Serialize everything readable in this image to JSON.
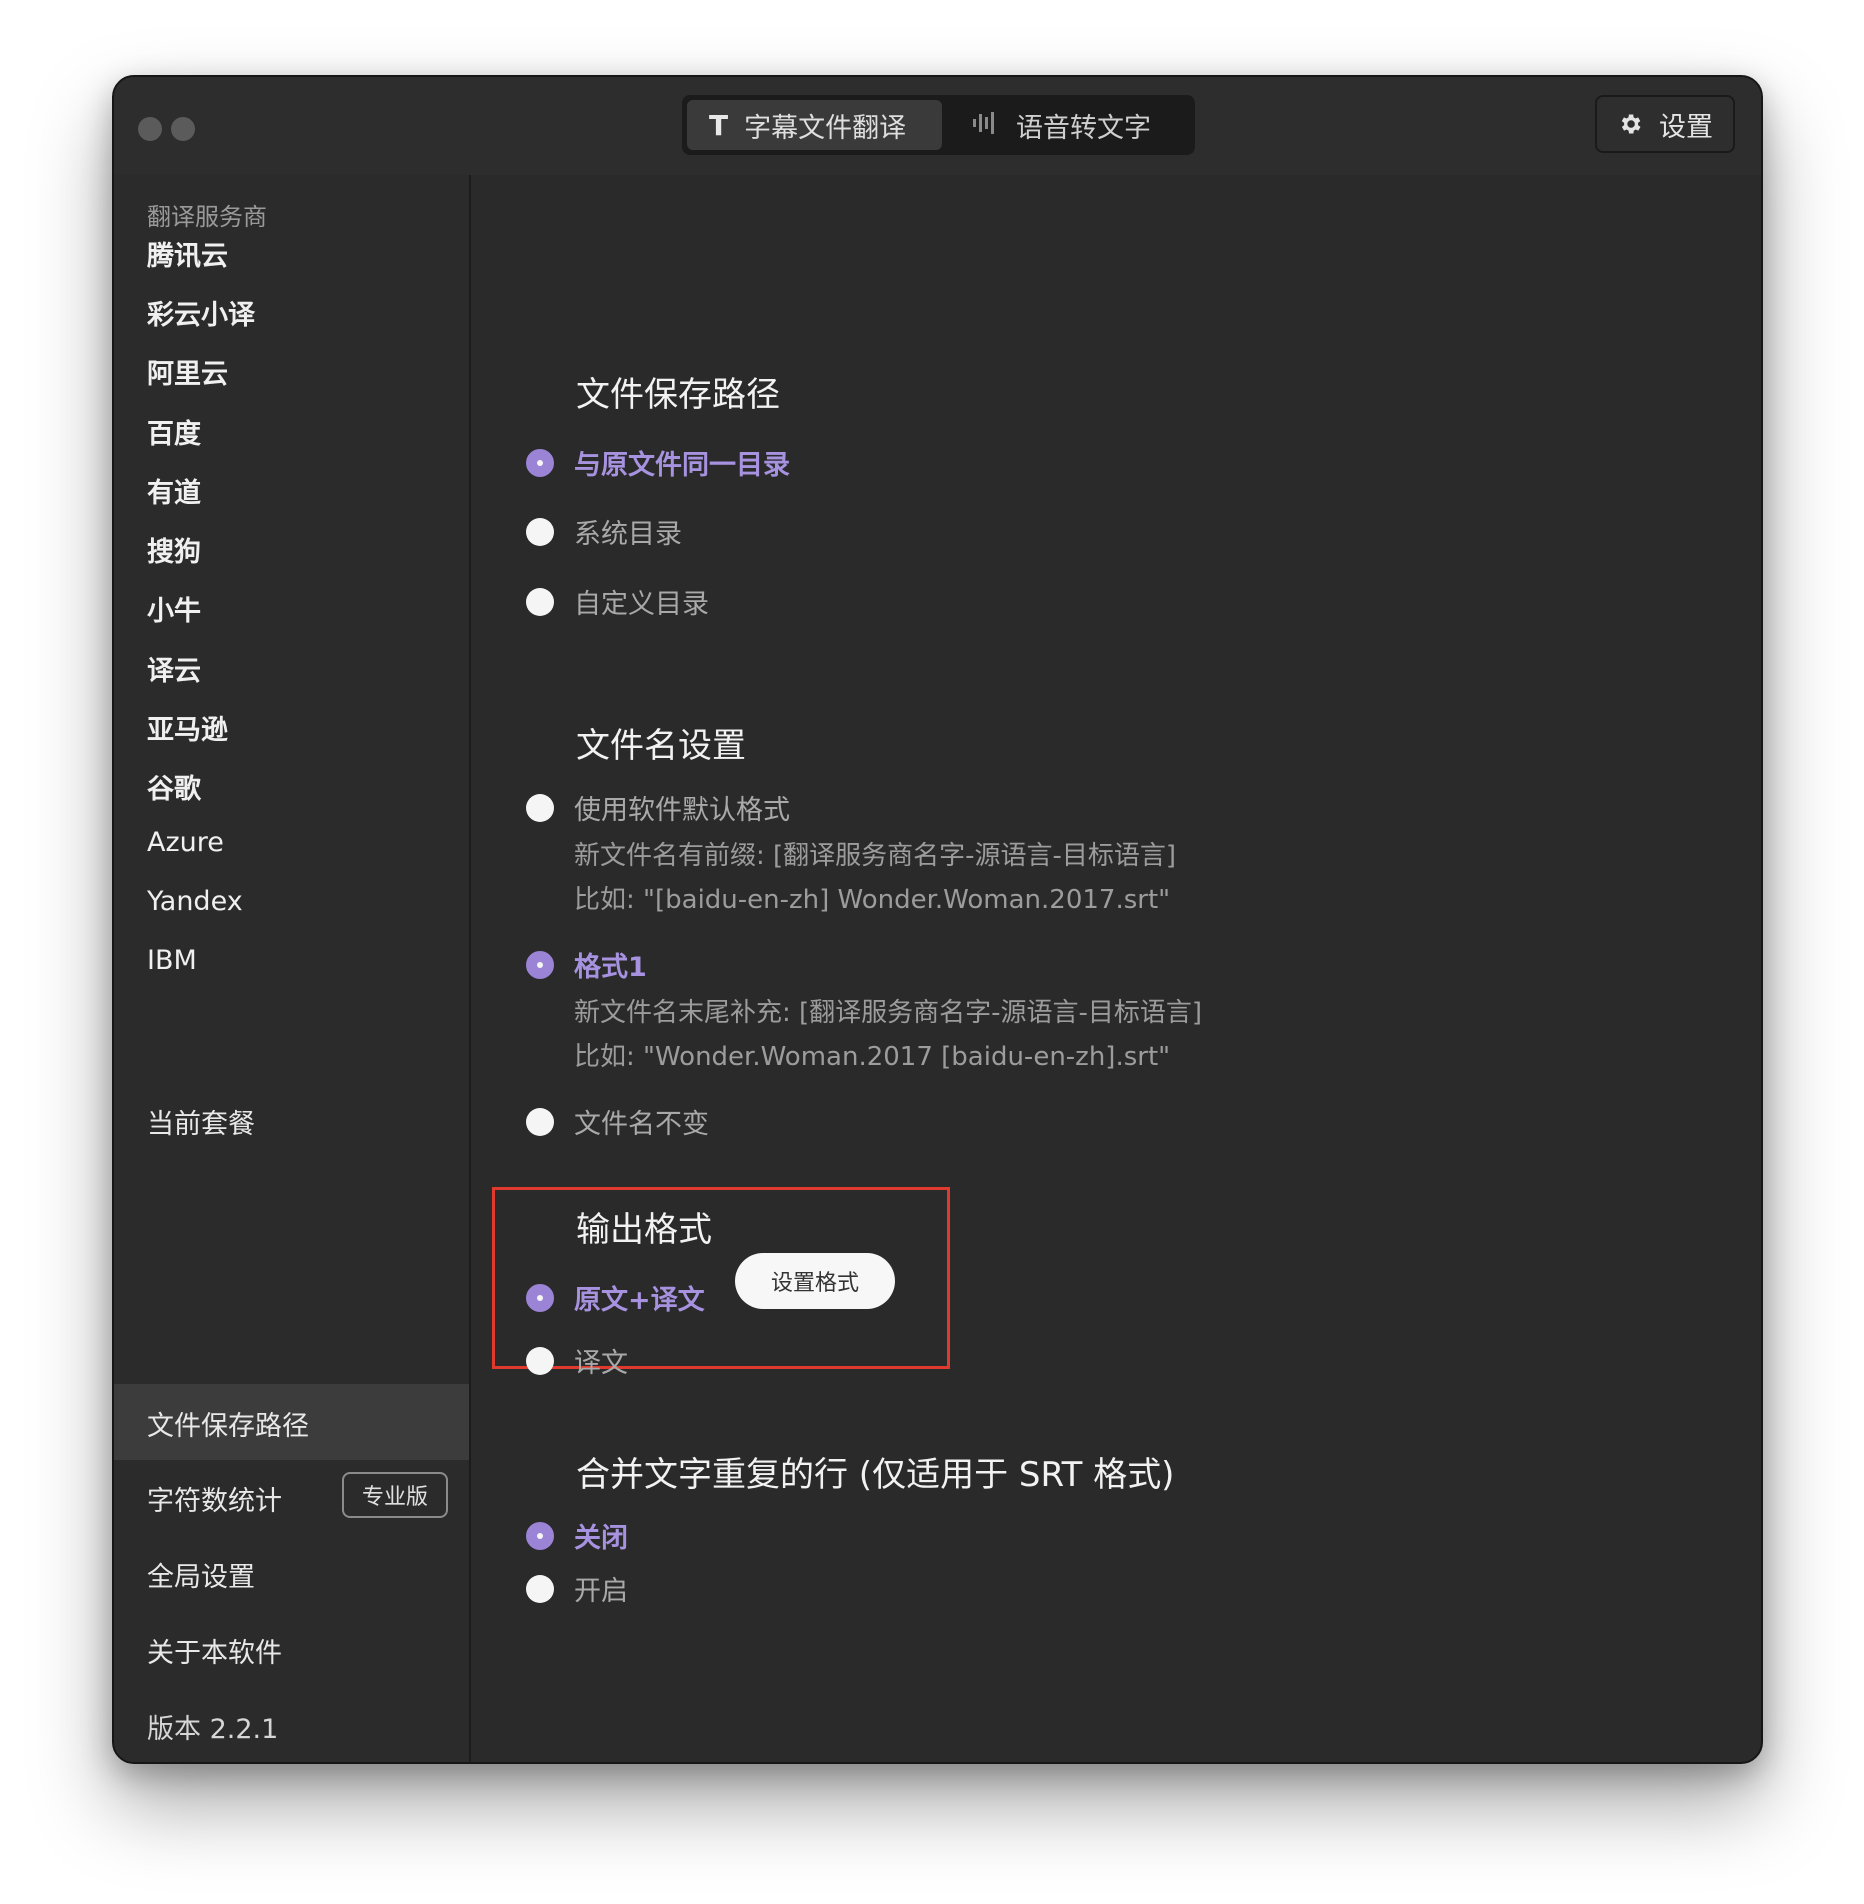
{
  "titlebar": {
    "tabs": [
      {
        "icon": "text-t-icon",
        "label": "字幕文件翻译",
        "active": true
      },
      {
        "icon": "waveform-icon",
        "label": "语音转文字",
        "active": false
      }
    ],
    "settings_label": "设置"
  },
  "sidebar": {
    "heading": "翻译服务商",
    "providers": [
      "腾讯云",
      "彩云小译",
      "阿里云",
      "百度",
      "有道",
      "搜狗",
      "小牛",
      "译云",
      "亚马逊",
      "谷歌",
      "Azure",
      "Yandex",
      "IBM"
    ],
    "bottom_items": {
      "plan": "当前套餐",
      "save_path": "文件保存路径",
      "char_count": "字符数统计",
      "pro_badge": "专业版",
      "global_settings": "全局设置",
      "about": "关于本软件",
      "version": "版本 2.2.1"
    },
    "active_item": "文件保存路径"
  },
  "main": {
    "save_path": {
      "title": "文件保存路径",
      "options": [
        {
          "label": "与原文件同一目录",
          "checked": true
        },
        {
          "label": "系统目录",
          "checked": false
        },
        {
          "label": "自定义目录",
          "checked": false
        }
      ]
    },
    "filename": {
      "title": "文件名设置",
      "options": [
        {
          "label": "使用软件默认格式",
          "checked": false,
          "desc1": "新文件名有前缀: [翻译服务商名字-源语言-目标语言]",
          "desc2": "比如: \"[baidu-en-zh] Wonder.Woman.2017.srt\""
        },
        {
          "label": "格式1",
          "checked": true,
          "desc1": "新文件名末尾补充: [翻译服务商名字-源语言-目标语言]",
          "desc2": "比如: \"Wonder.Woman.2017 [baidu-en-zh].srt\""
        },
        {
          "label": "文件名不变",
          "checked": false
        }
      ]
    },
    "output": {
      "title": "输出格式",
      "options": [
        {
          "label": "原文+译文",
          "checked": true
        },
        {
          "label": "译文",
          "checked": false
        }
      ],
      "format_button": "设置格式"
    },
    "merge": {
      "title": "合并文字重复的行 (仅适用于 SRT 格式)",
      "options": [
        {
          "label": "关闭",
          "checked": true
        },
        {
          "label": "开启",
          "checked": false
        }
      ]
    }
  },
  "colors": {
    "accent": "#9b84d6",
    "background": "#2a2a2b",
    "highlight_border": "#e03a2e"
  }
}
